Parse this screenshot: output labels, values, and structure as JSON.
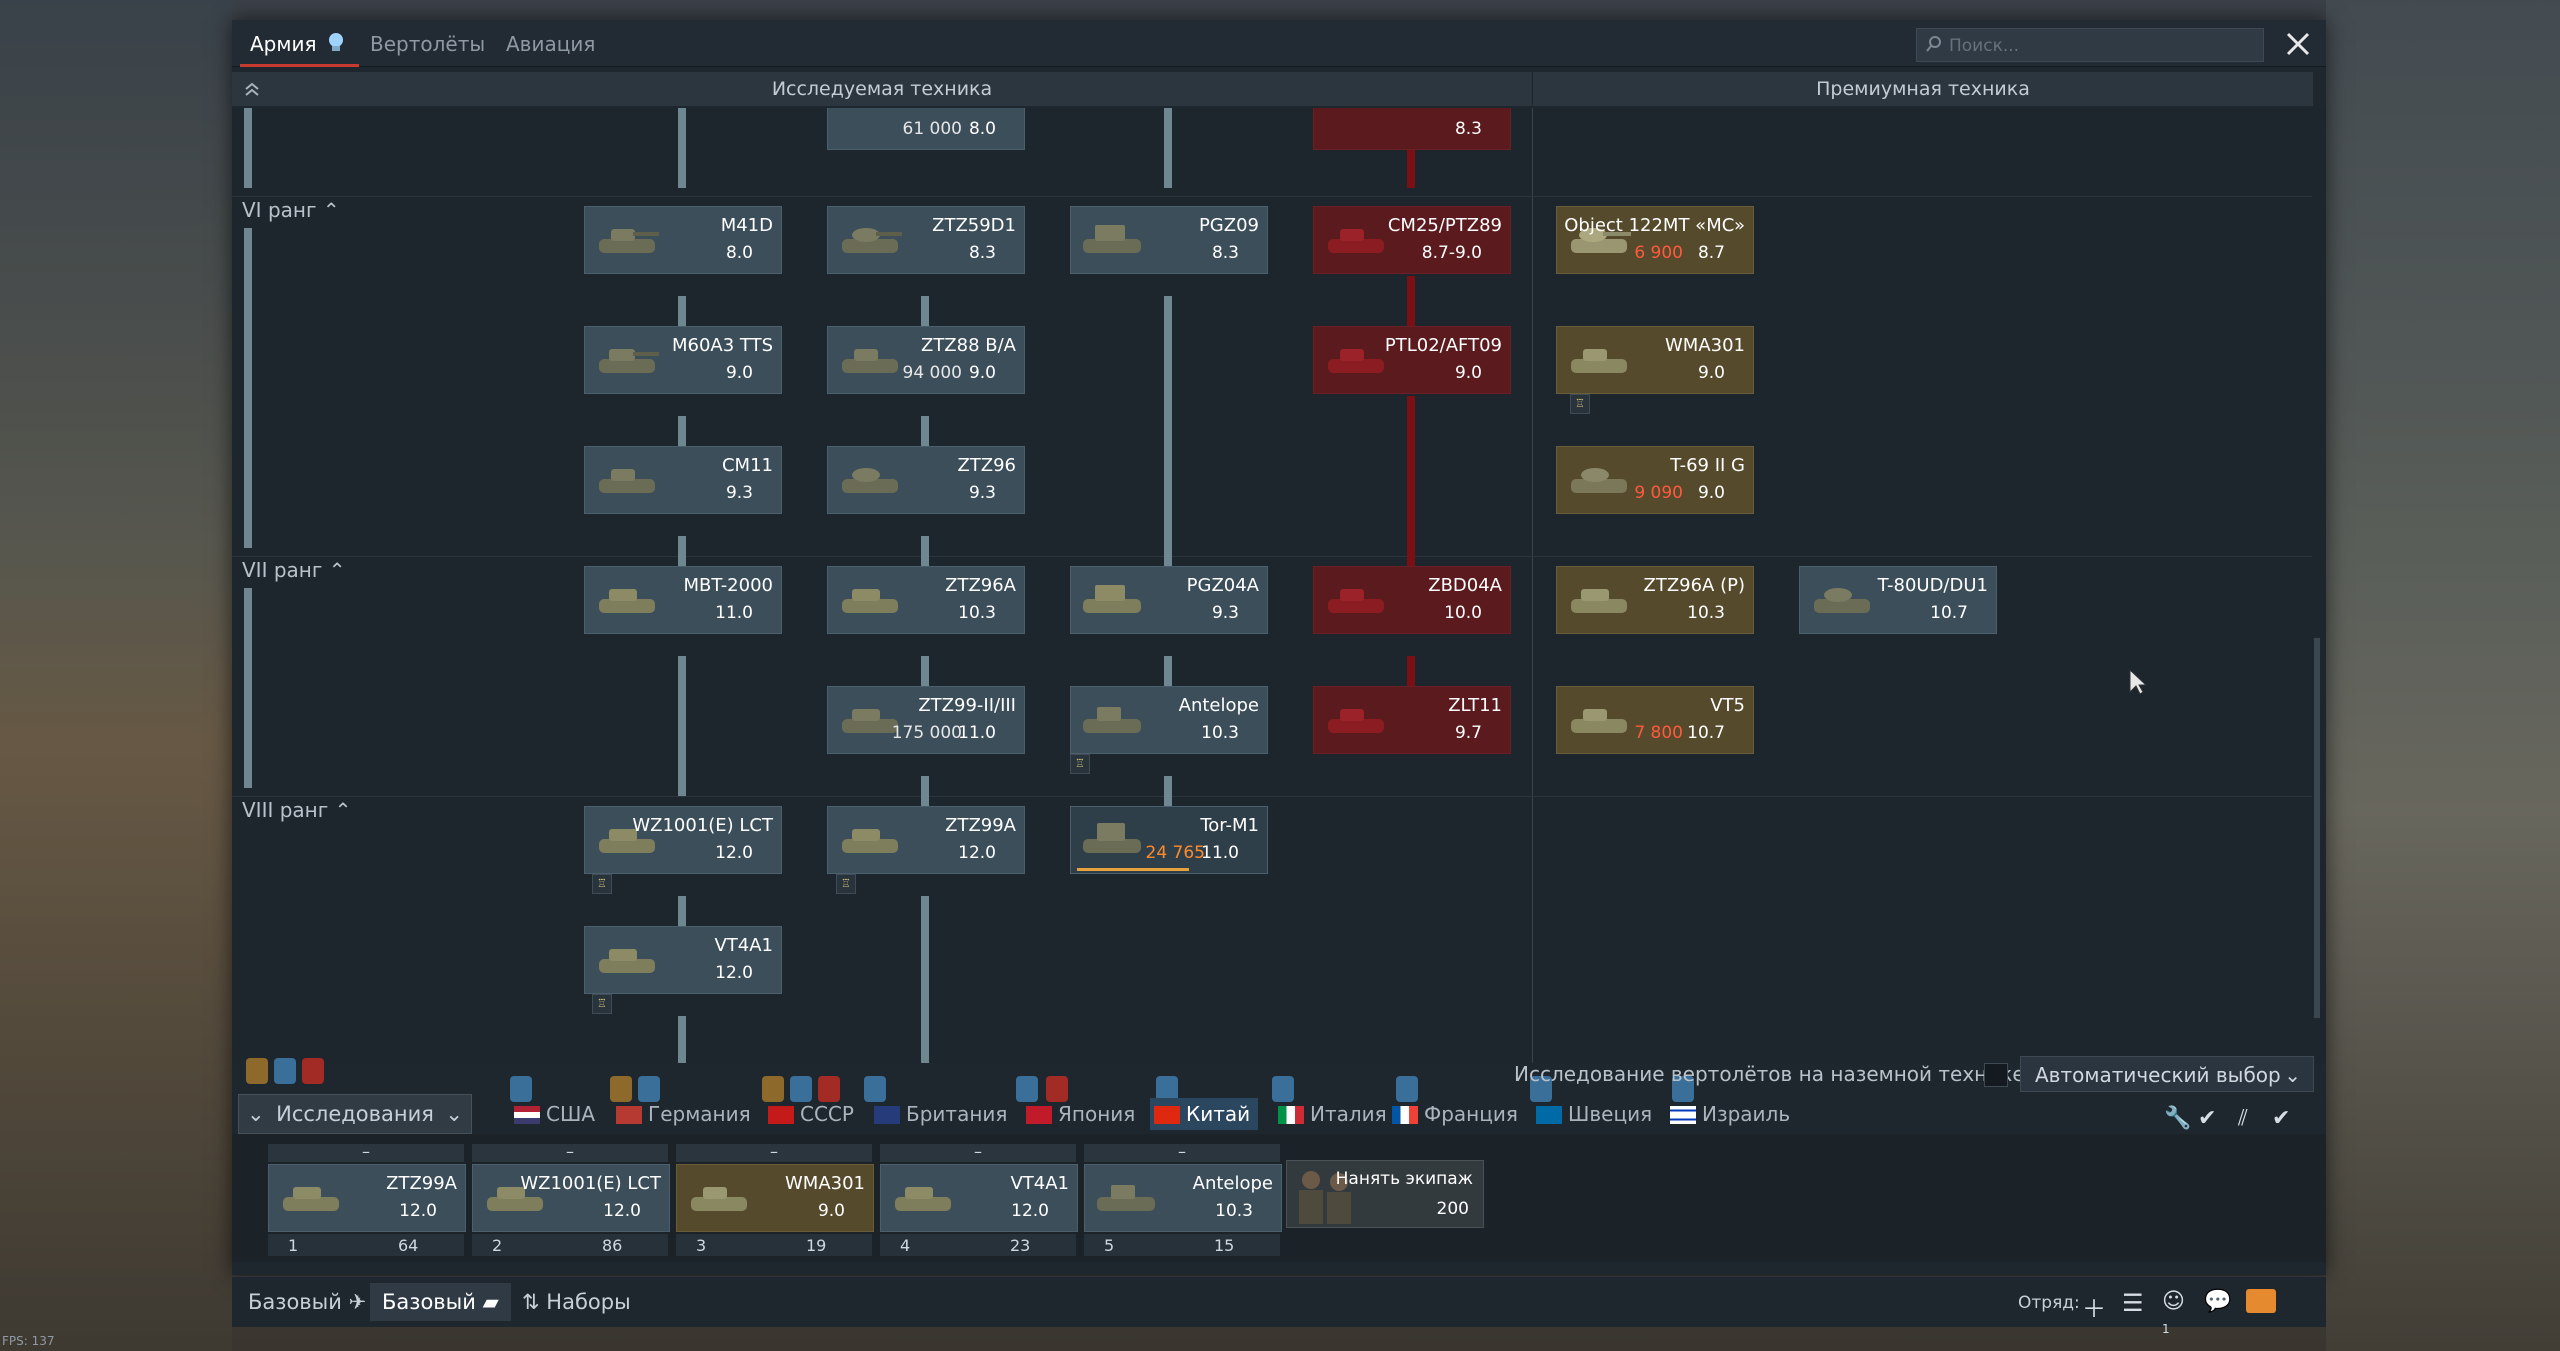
{
  "tabs": [
    {
      "label": "Армия"
    },
    {
      "label": "Вертолёты"
    },
    {
      "label": "Авиация"
    }
  ],
  "search": {
    "placeholder": "Поиск..."
  },
  "headers": {
    "researched": "Исследуемая техника",
    "premium": "Премиумная техника"
  },
  "ranks": [
    {
      "label": "VI ранг"
    },
    {
      "label": "VII ранг"
    },
    {
      "label": "VIII ранг"
    }
  ],
  "vehicles": {
    "top1": {
      "cost": "61 000",
      "br": "8.0"
    },
    "top2": {
      "br": "8.3"
    },
    "m41d": {
      "name": "M41D",
      "br": "8.0"
    },
    "ztz59d1": {
      "name": "ZTZ59D1",
      "br": "8.3"
    },
    "pgz09": {
      "name": "PGZ09",
      "br": "8.3"
    },
    "cm25": {
      "name": "CM25/PTZ89",
      "br": "8.7-9.0"
    },
    "obj122": {
      "name": "Object 122MT «MC»",
      "cost": "6 900",
      "br": "8.7"
    },
    "m60a3": {
      "name": "M60A3 TTS",
      "br": "9.0"
    },
    "ztz88": {
      "name": "ZTZ88 B/A",
      "cost": "94 000",
      "br": "9.0"
    },
    "ptl02": {
      "name": "PTL02/AFT09",
      "br": "9.0"
    },
    "wma301": {
      "name": "WMA301",
      "br": "9.0"
    },
    "cm11": {
      "name": "CM11",
      "br": "9.3"
    },
    "ztz96": {
      "name": "ZTZ96",
      "br": "9.3"
    },
    "t69": {
      "name": "T-69 II G",
      "cost": "9 090",
      "br": "9.0"
    },
    "mbt2000": {
      "name": "MBT-2000",
      "br": "11.0"
    },
    "ztz96a": {
      "name": "ZTZ96A",
      "br": "10.3"
    },
    "pgz04a": {
      "name": "PGZ04A",
      "br": "9.3"
    },
    "zbd04a": {
      "name": "ZBD04A",
      "br": "10.0"
    },
    "ztz96ap": {
      "name": "ZTZ96A (P)",
      "br": "10.3"
    },
    "t80ud": {
      "name": "T-80UD/DU1",
      "br": "10.7"
    },
    "ztz99": {
      "name": "ZTZ99-II/III",
      "cost": "175 000",
      "br": "11.0"
    },
    "antelope": {
      "name": "Antelope",
      "br": "10.3"
    },
    "zlt11": {
      "name": "ZLT11",
      "br": "9.7"
    },
    "vt5": {
      "name": "VT5",
      "cost": "7 800",
      "br": "10.7"
    },
    "wz1001": {
      "name": "WZ1001(E) LCT",
      "br": "12.0"
    },
    "ztz99a": {
      "name": "ZTZ99A",
      "br": "12.0"
    },
    "torm1": {
      "name": "Tor-M1",
      "cost": "24 765",
      "br": "11.0"
    },
    "vt4a1": {
      "name": "VT4A1",
      "br": "12.0"
    }
  },
  "heli_research": "Исследование вертолётов на наземной технике",
  "auto_select": "Автоматический выбор",
  "research_button": "Исследования",
  "nations": [
    {
      "label": "США"
    },
    {
      "label": "Германия"
    },
    {
      "label": "СССР"
    },
    {
      "label": "Британия"
    },
    {
      "label": "Япония"
    },
    {
      "label": "Китай"
    },
    {
      "label": "Италия"
    },
    {
      "label": "Франция"
    },
    {
      "label": "Швеция"
    },
    {
      "label": "Израиль"
    }
  ],
  "slots": [
    {
      "top": "–",
      "name": "ZTZ99A",
      "br": "12.0",
      "crew": "1",
      "sp": "64"
    },
    {
      "top": "–",
      "name": "WZ1001(E) LCT",
      "br": "12.0",
      "crew": "2",
      "sp": "86"
    },
    {
      "top": "–",
      "name": "WMA301",
      "br": "9.0",
      "crew": "3",
      "sp": "19"
    },
    {
      "top": "–",
      "name": "VT4A1",
      "br": "12.0",
      "crew": "4",
      "sp": "23"
    },
    {
      "top": "–",
      "name": "Antelope",
      "br": "10.3",
      "crew": "5",
      "sp": "15"
    }
  ],
  "hire": {
    "label": "Нанять экипаж",
    "cost": "200"
  },
  "bottom": {
    "preset1": "Базовый",
    "preset2": "Базовый",
    "sets": "Наборы",
    "squad": "Отряд:",
    "friends_count": "1"
  },
  "fps": "FPS: 137",
  "colors": {
    "accent": "#c73a2e",
    "tree_line": "#6e8791",
    "red_branch": "#7a0f14",
    "premium_gold": "#564a2c",
    "active_nation": "#2b4760"
  }
}
